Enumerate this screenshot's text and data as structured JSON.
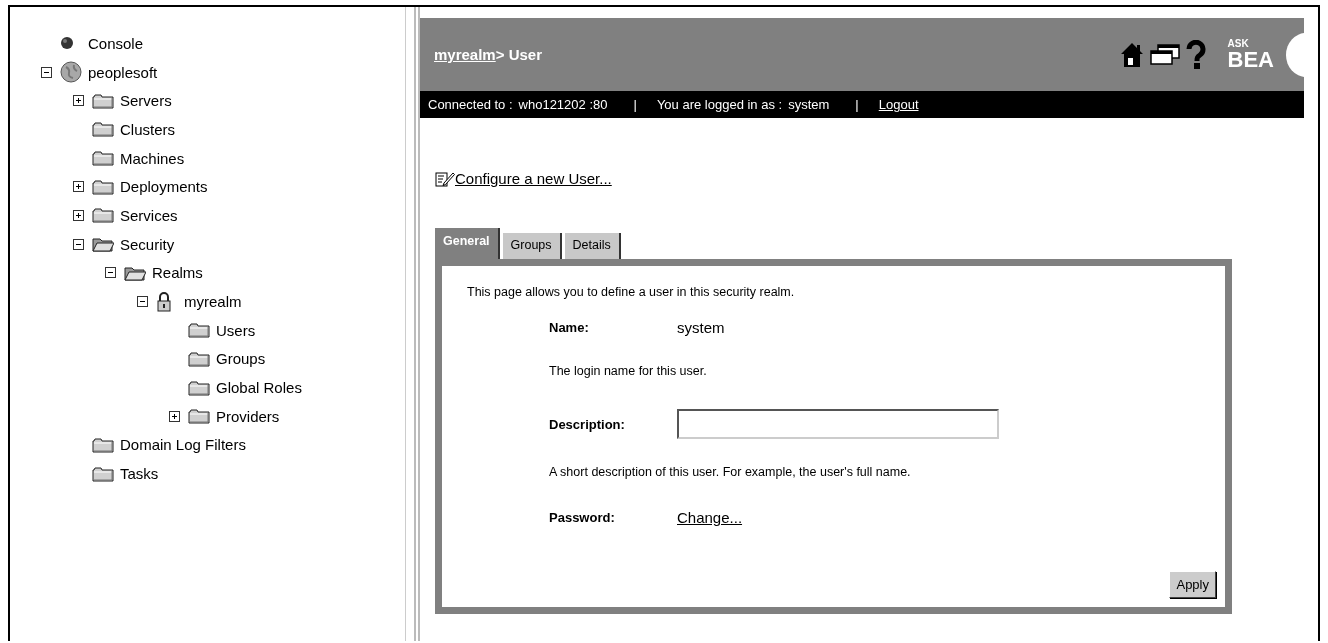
{
  "tree": [
    {
      "label": "Console",
      "kind": "console"
    },
    {
      "label": "peoplesoft",
      "kind": "domain",
      "expanded": true,
      "children": [
        {
          "label": "Servers",
          "kind": "folder",
          "expanded": false
        },
        {
          "label": "Clusters",
          "kind": "folder"
        },
        {
          "label": "Machines",
          "kind": "folder"
        },
        {
          "label": "Deployments",
          "kind": "folder",
          "expanded": false
        },
        {
          "label": "Services",
          "kind": "folder",
          "expanded": false
        },
        {
          "label": "Security",
          "kind": "folder",
          "expanded": true,
          "children": [
            {
              "label": "Realms",
              "kind": "folder",
              "expanded": true,
              "children": [
                {
                  "label": "myrealm",
                  "kind": "lock",
                  "expanded": true,
                  "children": [
                    {
                      "label": "Users",
                      "kind": "folder"
                    },
                    {
                      "label": "Groups",
                      "kind": "folder"
                    },
                    {
                      "label": "Global Roles",
                      "kind": "folder"
                    },
                    {
                      "label": "Providers",
                      "kind": "folder",
                      "expanded": false
                    }
                  ]
                }
              ]
            }
          ]
        },
        {
          "label": "Domain Log Filters",
          "kind": "folder"
        },
        {
          "label": "Tasks",
          "kind": "folder"
        }
      ]
    }
  ],
  "header": {
    "breadcrumb_link": "myrealm",
    "title": "> User",
    "logo_small": "ASK",
    "logo": "BEA"
  },
  "status_bar": {
    "connected_label": "Connected to :",
    "connected_value": "who121202 :80",
    "separator_1": "|",
    "user_label": "You are logged in as :",
    "user_value": "system",
    "separator_2": "|",
    "logout": "Logout"
  },
  "configure_link": "Configure a new User...",
  "tabs": [
    {
      "label": "General",
      "selected": true
    },
    {
      "label": "Groups",
      "selected": false
    },
    {
      "label": "Details",
      "selected": false
    }
  ],
  "form": {
    "intro": "This page allows you to define a user in this security realm.",
    "name_label": "Name:",
    "name_value": "system",
    "name_help": "The login name for this user.",
    "description_label": "Description:",
    "description_help": "A short description of this user. For example, the user's full name.",
    "password_label": "Password:",
    "password_link": "Change...",
    "apply": "Apply"
  }
}
